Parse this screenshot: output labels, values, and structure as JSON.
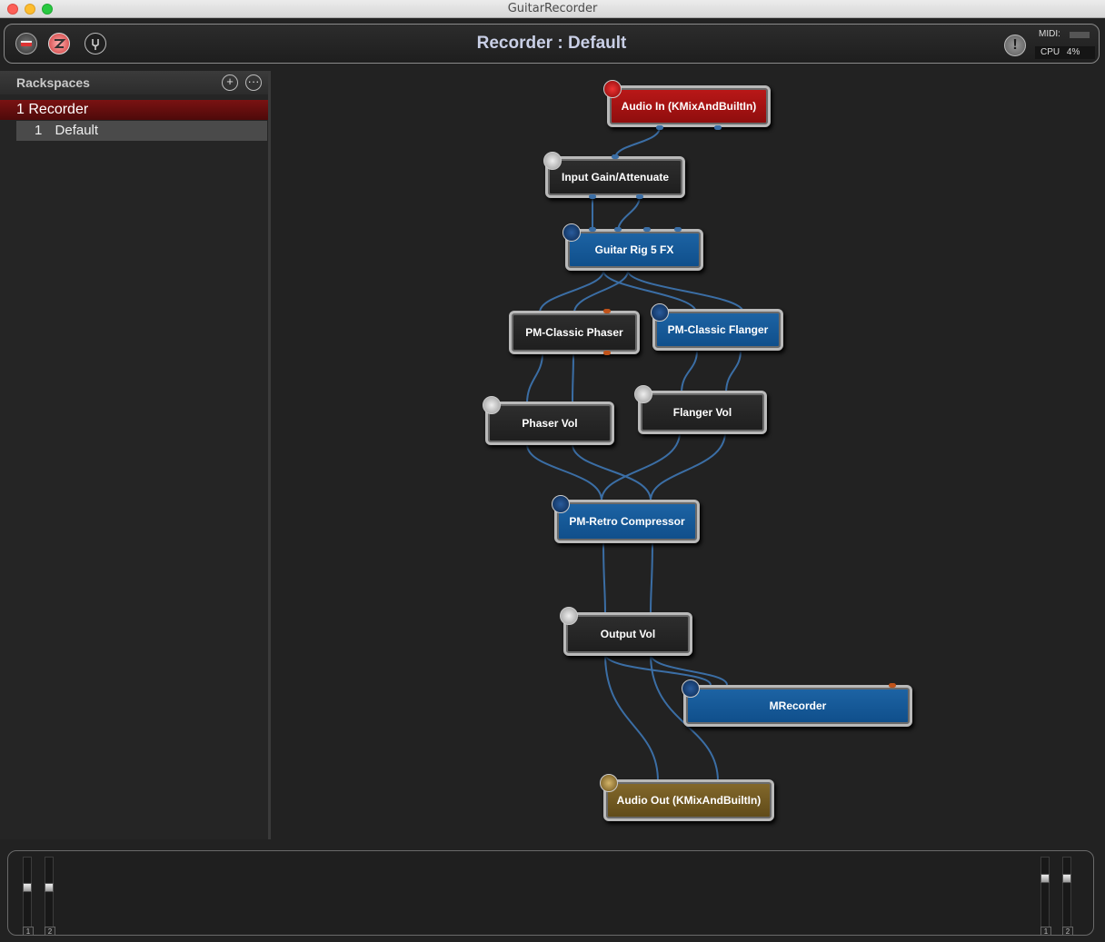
{
  "window": {
    "title": "GuitarRecorder"
  },
  "toolbar": {
    "title": "Recorder : Default",
    "midi_label": "MIDI:",
    "cpu_label": "CPU",
    "cpu_value": "4%"
  },
  "sidebar": {
    "header": "Rackspaces",
    "rackspace": {
      "number": "1",
      "name": "Recorder"
    },
    "variation": {
      "number": "1",
      "name": "Default"
    }
  },
  "nodes": {
    "audio_in": "Audio In (KMixAndBuiltIn)",
    "input_gain": "Input Gain/Attenuate",
    "guitar_rig": "Guitar Rig 5 FX",
    "phaser": "PM-Classic Phaser",
    "flanger": "PM-Classic Flanger",
    "phaser_vol": "Phaser Vol",
    "flanger_vol": "Flanger Vol",
    "compressor": "PM-Retro Compressor",
    "output_vol": "Output Vol",
    "mrecorder": "MRecorder",
    "audio_out": "Audio Out (KMixAndBuiltIn)"
  },
  "meters": {
    "left": [
      "1",
      "2"
    ],
    "right": [
      "1",
      "2"
    ]
  },
  "colors": {
    "plugin_blue": "#155a99",
    "audio_in_red": "#a81414",
    "audio_out_gold": "#725a22",
    "wire_blue": "#3b6ea5",
    "rackspace_selected": "#6a1010"
  }
}
